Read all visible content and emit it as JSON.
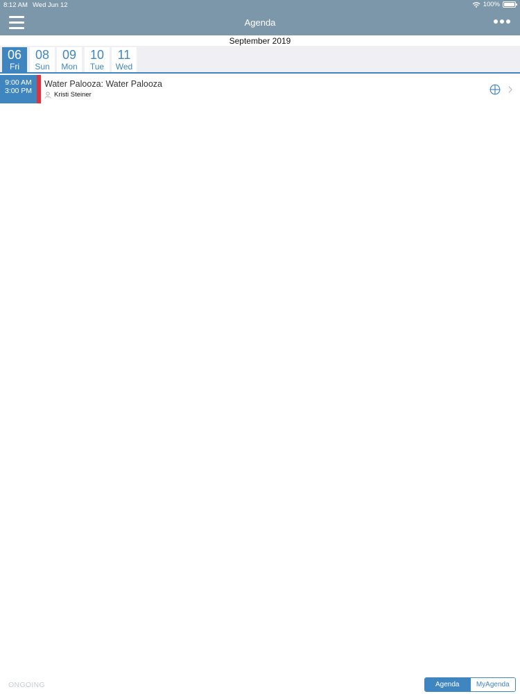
{
  "status_bar": {
    "time": "8:12 AM",
    "date": "Wed Jun 12",
    "battery": "100%"
  },
  "nav": {
    "title": "Agenda"
  },
  "month": "September 2019",
  "dates": [
    {
      "num": "06",
      "day": "Fri",
      "active": true
    },
    {
      "num": "08",
      "day": "Sun",
      "active": false
    },
    {
      "num": "09",
      "day": "Mon",
      "active": false
    },
    {
      "num": "10",
      "day": "Tue",
      "active": false
    },
    {
      "num": "11",
      "day": "Wed",
      "active": false
    }
  ],
  "agenda_items": [
    {
      "start": "9:00 AM",
      "end": "3:00 PM",
      "title": "Water Palooza: Water Palooza",
      "speaker": "Kristi Steiner",
      "color": "#e0313c"
    }
  ],
  "footer": {
    "ongoing": "ONGOING",
    "segments": [
      "Agenda",
      "MyAgenda"
    ],
    "active_segment": "Agenda"
  },
  "colors": {
    "header": "#7d97aa",
    "accent": "#3f86c0",
    "strip_bg": "#efeff4"
  }
}
